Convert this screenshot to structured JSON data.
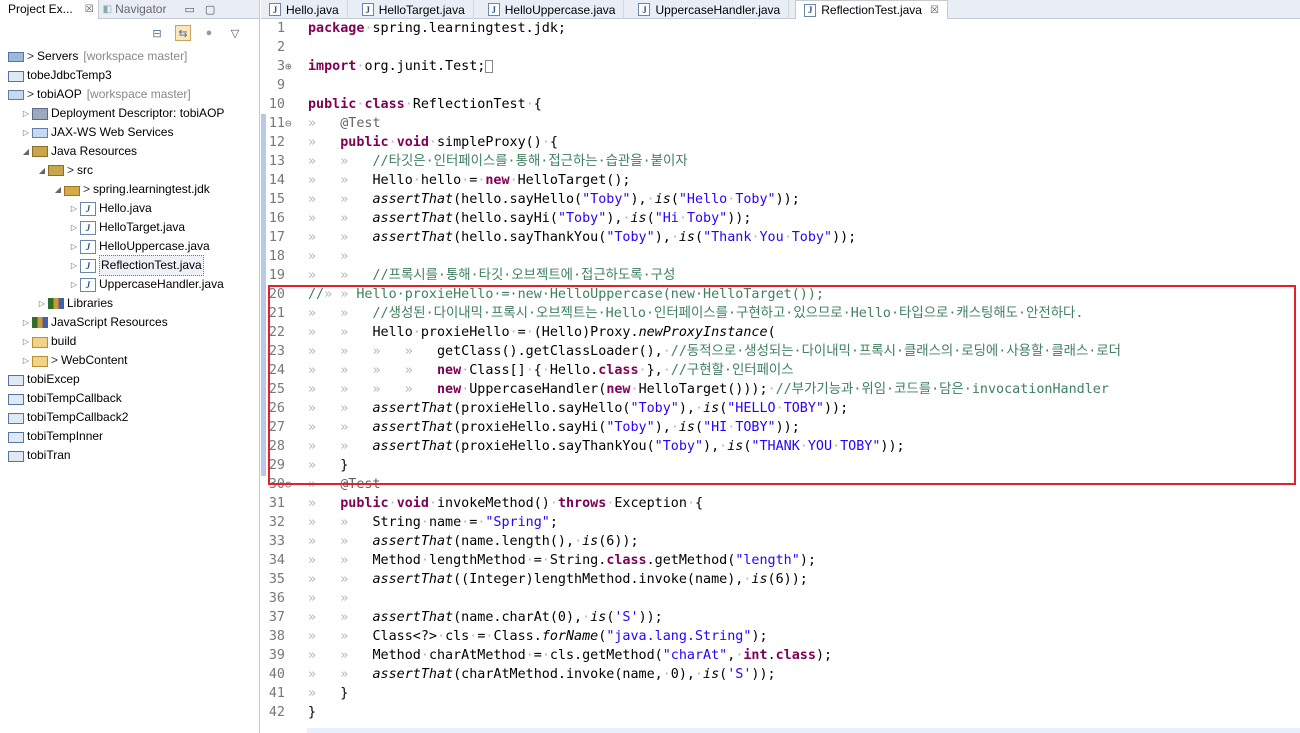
{
  "left_panel": {
    "tabs": [
      {
        "label": "Project Ex...",
        "close": "☒"
      },
      {
        "label": "Navigator"
      }
    ],
    "tree": [
      {
        "depth": 0,
        "arrow": "",
        "icon": "server-icon",
        "label": "Servers",
        "prefix": ">",
        "suffix": "[workspace master]"
      },
      {
        "depth": 0,
        "arrow": "",
        "icon": "project-icon",
        "label": "tobeJdbcTemp3",
        "prefix": "",
        "suffix": ""
      },
      {
        "depth": 0,
        "arrow": "",
        "icon": "web-project-icon",
        "label": "tobiAOP",
        "prefix": ">",
        "suffix": "[workspace master]"
      },
      {
        "depth": 1,
        "arrow": "▷",
        "icon": "deployment-descriptor-icon",
        "label": "Deployment Descriptor: tobiAOP",
        "prefix": "",
        "suffix": ""
      },
      {
        "depth": 1,
        "arrow": "▷",
        "icon": "web-services-icon",
        "label": "JAX-WS Web Services",
        "prefix": "",
        "suffix": ""
      },
      {
        "depth": 1,
        "arrow": "◢",
        "icon": "java-resources-icon",
        "label": "Java Resources",
        "prefix": "",
        "suffix": ""
      },
      {
        "depth": 2,
        "arrow": "◢",
        "icon": "source-folder-icon",
        "label": "src",
        "prefix": ">",
        "suffix": ""
      },
      {
        "depth": 3,
        "arrow": "◢",
        "icon": "package-icon",
        "label": "spring.learningtest.jdk",
        "prefix": ">",
        "suffix": ""
      },
      {
        "depth": 4,
        "arrow": "▷",
        "icon": "java-file-icon",
        "label": "Hello.java",
        "prefix": "",
        "suffix": ""
      },
      {
        "depth": 4,
        "arrow": "▷",
        "icon": "java-file-icon",
        "label": "HelloTarget.java",
        "prefix": "",
        "suffix": ""
      },
      {
        "depth": 4,
        "arrow": "▷",
        "icon": "java-file-icon",
        "label": "HelloUppercase.java",
        "prefix": "",
        "suffix": ""
      },
      {
        "depth": 4,
        "arrow": "▷",
        "icon": "java-file-icon",
        "label": "ReflectionTest.java",
        "prefix": "",
        "suffix": "",
        "selected": true
      },
      {
        "depth": 4,
        "arrow": "▷",
        "icon": "java-file-icon",
        "label": "UppercaseHandler.java",
        "prefix": "",
        "suffix": ""
      },
      {
        "depth": 2,
        "arrow": "▷",
        "icon": "libraries-icon",
        "label": "Libraries",
        "prefix": "",
        "suffix": ""
      },
      {
        "depth": 1,
        "arrow": "▷",
        "icon": "javascript-resources-icon",
        "label": "JavaScript Resources",
        "prefix": "",
        "suffix": ""
      },
      {
        "depth": 1,
        "arrow": "▷",
        "icon": "folder-icon",
        "label": "build",
        "prefix": "",
        "suffix": ""
      },
      {
        "depth": 1,
        "arrow": "▷",
        "icon": "folder-icon",
        "label": "WebContent",
        "prefix": ">",
        "suffix": ""
      },
      {
        "depth": 0,
        "arrow": "",
        "icon": "project-icon",
        "label": "tobiExcep",
        "prefix": "",
        "suffix": ""
      },
      {
        "depth": 0,
        "arrow": "",
        "icon": "project-icon",
        "label": "tobiTempCallback",
        "prefix": "",
        "suffix": ""
      },
      {
        "depth": 0,
        "arrow": "",
        "icon": "project-icon",
        "label": "tobiTempCallback2",
        "prefix": "",
        "suffix": ""
      },
      {
        "depth": 0,
        "arrow": "",
        "icon": "project-icon",
        "label": "tobiTempInner",
        "prefix": "",
        "suffix": ""
      },
      {
        "depth": 0,
        "arrow": "",
        "icon": "project-icon",
        "label": "tobiTran",
        "prefix": "",
        "suffix": ""
      }
    ]
  },
  "editor": {
    "tabs": [
      {
        "label": "Hello.java",
        "active": false
      },
      {
        "label": "HelloTarget.java",
        "active": false
      },
      {
        "label": "HelloUppercase.java",
        "active": false
      },
      {
        "label": "UppercaseHandler.java",
        "active": false
      },
      {
        "label": "ReflectionTest.java",
        "active": true
      }
    ],
    "lines": [
      {
        "n": "1",
        "fold": "",
        "html": "<span class=\"kw\">package</span><span class=\"ws\">·</span>spring.learningtest.jdk;"
      },
      {
        "n": "2",
        "fold": "",
        "html": ""
      },
      {
        "n": "3",
        "fold": "⊕",
        "html": "<span class=\"kw\">import</span><span class=\"ws\">·</span>org.junit.Test;<span style=\"border:1px solid #888;display:inline-block;width:8px;height:13px;vertical-align:middle\"></span>"
      },
      {
        "n": "9",
        "fold": "",
        "html": ""
      },
      {
        "n": "10",
        "fold": "",
        "html": "<span class=\"kw\">public</span><span class=\"ws\">·</span><span class=\"kw\">class</span><span class=\"ws\">·</span>ReflectionTest<span class=\"ws\">·</span>{"
      },
      {
        "n": "11",
        "fold": "⊖",
        "html": "<span class=\"ws\">»   </span><span class=\"ann\">@Test</span>"
      },
      {
        "n": "12",
        "fold": "",
        "html": "<span class=\"ws\">»   </span><span class=\"kw\">public</span><span class=\"ws\">·</span><span class=\"kw\">void</span><span class=\"ws\">·</span>simpleProxy()<span class=\"ws\">·</span>{"
      },
      {
        "n": "13",
        "fold": "",
        "html": "<span class=\"ws\">»   »   </span><span class=\"cm\">//타깃은·인터페이스를·통해·접근하는·습관을·붙이자</span>"
      },
      {
        "n": "14",
        "fold": "",
        "html": "<span class=\"ws\">»   »   </span>Hello<span class=\"ws\">·</span>hello<span class=\"ws\">·</span>=<span class=\"ws\">·</span><span class=\"kw\">new</span><span class=\"ws\">·</span>HelloTarget();"
      },
      {
        "n": "15",
        "fold": "",
        "html": "<span class=\"ws\">»   »   </span><span class=\"it\">assertThat</span>(hello.sayHello(<span class=\"str\">\"Toby\"</span>),<span class=\"ws\">·</span><span class=\"it\">is</span>(<span class=\"str\">\"Hello<span class=\"ws\">·</span>Toby\"</span>));"
      },
      {
        "n": "16",
        "fold": "",
        "html": "<span class=\"ws\">»   »   </span><span class=\"it\">assertThat</span>(hello.sayHi(<span class=\"str\">\"Toby\"</span>),<span class=\"ws\">·</span><span class=\"it\">is</span>(<span class=\"str\">\"Hi<span class=\"ws\">·</span>Toby\"</span>));"
      },
      {
        "n": "17",
        "fold": "",
        "html": "<span class=\"ws\">»   »   </span><span class=\"it\">assertThat</span>(hello.sayThankYou(<span class=\"str\">\"Toby\"</span>),<span class=\"ws\">·</span><span class=\"it\">is</span>(<span class=\"str\">\"Thank<span class=\"ws\">·</span>You<span class=\"ws\">·</span>Toby\"</span>));"
      },
      {
        "n": "18",
        "fold": "",
        "html": "<span class=\"ws\">»   »</span>"
      },
      {
        "n": "19",
        "fold": "",
        "html": "<span class=\"ws\">»   »   </span><span class=\"cm\">//프록시를·통해·타깃·오브젝트에·접근하도록·구성</span>"
      },
      {
        "n": "20",
        "fold": "",
        "html": "<span class=\"cm\">//</span><span class=\"ws\">» » </span><span class=\"cm\">Hello·proxieHello·=·new·HelloUppercase(new·HelloTarget());</span>"
      },
      {
        "n": "21",
        "fold": "",
        "html": "<span class=\"ws\">»   »   </span><span class=\"cm\">//생성된·다이내믹·프록시·오브젝트는·Hello·인터페이스를·구현하고·있으므로·Hello·타입으로·캐스팅해도·안전하다.</span>"
      },
      {
        "n": "22",
        "fold": "",
        "html": "<span class=\"ws\">»   »   </span>Hello<span class=\"ws\">·</span>proxieHello<span class=\"ws\">·</span>=<span class=\"ws\">·</span>(Hello)Proxy.<span class=\"it\">newProxyInstance</span>("
      },
      {
        "n": "23",
        "fold": "",
        "html": "<span class=\"ws\">»   »   »   »   </span>getClass().getClassLoader(),<span class=\"ws\">·</span><span class=\"cm\">//동적으로·생성되는·다이내믹·프록시·클래스의·로딩에·사용할·클래스·로더</span>"
      },
      {
        "n": "24",
        "fold": "",
        "html": "<span class=\"ws\">»   »   »   »   </span><span class=\"kw\">new</span><span class=\"ws\">·</span>Class[]<span class=\"ws\">·</span>{<span class=\"ws\">·</span>Hello.<span class=\"kw\">class</span><span class=\"ws\">·</span>},<span class=\"ws\">·</span><span class=\"cm\">//구현할·인터페이스</span>"
      },
      {
        "n": "25",
        "fold": "",
        "html": "<span class=\"ws\">»   »   »   »   </span><span class=\"kw\">new</span><span class=\"ws\">·</span>UppercaseHandler(<span class=\"kw\">new</span><span class=\"ws\">·</span>HelloTarget()));<span class=\"ws\">·</span><span class=\"cm\">//부가기능과·위임·코드를·담은·invocationHandler</span>"
      },
      {
        "n": "26",
        "fold": "",
        "html": "<span class=\"ws\">»   »   </span><span class=\"it\">assertThat</span>(proxieHello.sayHello(<span class=\"str\">\"Toby\"</span>),<span class=\"ws\">·</span><span class=\"it\">is</span>(<span class=\"str\">\"HELLO<span class=\"ws\">·</span>TOBY\"</span>));"
      },
      {
        "n": "27",
        "fold": "",
        "html": "<span class=\"ws\">»   »   </span><span class=\"it\">assertThat</span>(proxieHello.sayHi(<span class=\"str\">\"Toby\"</span>),<span class=\"ws\">·</span><span class=\"it\">is</span>(<span class=\"str\">\"HI<span class=\"ws\">·</span>TOBY\"</span>));"
      },
      {
        "n": "28",
        "fold": "",
        "html": "<span class=\"ws\">»   »   </span><span class=\"it\">assertThat</span>(proxieHello.sayThankYou(<span class=\"str\">\"Toby\"</span>),<span class=\"ws\">·</span><span class=\"it\">is</span>(<span class=\"str\">\"THANK<span class=\"ws\">·</span>YOU<span class=\"ws\">·</span>TOBY\"</span>));"
      },
      {
        "n": "29",
        "fold": "",
        "html": "<span class=\"ws\">»   </span>}"
      },
      {
        "n": "30",
        "fold": "⊖",
        "html": "<span class=\"ws\">»   </span><span class=\"ann\">@Test</span>"
      },
      {
        "n": "31",
        "fold": "",
        "html": "<span class=\"ws\">»   </span><span class=\"kw\">public</span><span class=\"ws\">·</span><span class=\"kw\">void</span><span class=\"ws\">·</span>invokeMethod()<span class=\"ws\">·</span><span class=\"kw\">throws</span><span class=\"ws\">·</span>Exception<span class=\"ws\">·</span>{"
      },
      {
        "n": "32",
        "fold": "",
        "html": "<span class=\"ws\">»   »   </span>String<span class=\"ws\">·</span>name<span class=\"ws\">·</span>=<span class=\"ws\">·</span><span class=\"str\">\"Spring\"</span>;"
      },
      {
        "n": "33",
        "fold": "",
        "html": "<span class=\"ws\">»   »   </span><span class=\"it\">assertThat</span>(name.length(),<span class=\"ws\">·</span><span class=\"it\">is</span>(6));"
      },
      {
        "n": "34",
        "fold": "",
        "html": "<span class=\"ws\">»   »   </span>Method<span class=\"ws\">·</span>lengthMethod<span class=\"ws\">·</span>=<span class=\"ws\">·</span>String.<span class=\"kw\">class</span>.getMethod(<span class=\"str\">\"length\"</span>);"
      },
      {
        "n": "35",
        "fold": "",
        "html": "<span class=\"ws\">»   »   </span><span class=\"it\">assertThat</span>((Integer)lengthMethod.invoke(name),<span class=\"ws\">·</span><span class=\"it\">is</span>(6));"
      },
      {
        "n": "36",
        "fold": "",
        "html": "<span class=\"ws\">»   »</span>"
      },
      {
        "n": "37",
        "fold": "",
        "html": "<span class=\"ws\">»   »   </span><span class=\"it\">assertThat</span>(name.charAt(0),<span class=\"ws\">·</span><span class=\"it\">is</span>(<span class=\"str\">'S'</span>));"
      },
      {
        "n": "38",
        "fold": "",
        "html": "<span class=\"ws\">»   »   </span>Class&lt;?&gt;<span class=\"ws\">·</span>cls<span class=\"ws\">·</span>=<span class=\"ws\">·</span>Class.<span class=\"it\">forName</span>(<span class=\"str\">\"java.lang.String\"</span>);"
      },
      {
        "n": "39",
        "fold": "",
        "html": "<span class=\"ws\">»   »   </span>Method<span class=\"ws\">·</span>charAtMethod<span class=\"ws\">·</span>=<span class=\"ws\">·</span>cls.getMethod(<span class=\"str\">\"charAt\"</span>,<span class=\"ws\">·</span><span class=\"kw\">int</span>.<span class=\"kw\">class</span>);"
      },
      {
        "n": "40",
        "fold": "",
        "html": "<span class=\"ws\">»   »   </span><span class=\"it\">assertThat</span>(charAtMethod.invoke(name,<span class=\"ws\">·</span>0),<span class=\"ws\">·</span><span class=\"it\">is</span>(<span class=\"str\">'S'</span>));"
      },
      {
        "n": "41",
        "fold": "",
        "html": "<span class=\"ws\">»   </span>}"
      },
      {
        "n": "42",
        "fold": "",
        "html": "}"
      }
    ]
  }
}
